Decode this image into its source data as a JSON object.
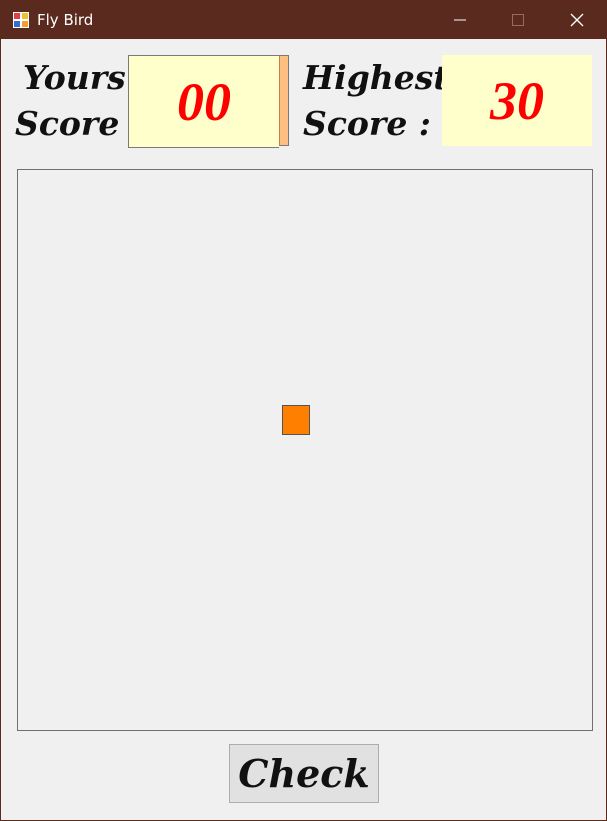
{
  "window": {
    "title": "Fly Bird",
    "icon": "app-grid-icon",
    "buttons": [
      "minimize-icon",
      "maximize-icon",
      "close-icon"
    ]
  },
  "scoreboard": {
    "your_label_line1": "Yours",
    "your_label_line2": "Score :",
    "your_score": "00",
    "highest_label_line1": "Highest",
    "highest_label_line2": "Score :",
    "highest_score": "30"
  },
  "game": {
    "bird_color": "#ff8000"
  },
  "controls": {
    "check_label": "Check"
  },
  "colors": {
    "titlebar": "#5a2a1e",
    "score_box_bg": "#ffffcc",
    "score_text": "#ff0000"
  }
}
